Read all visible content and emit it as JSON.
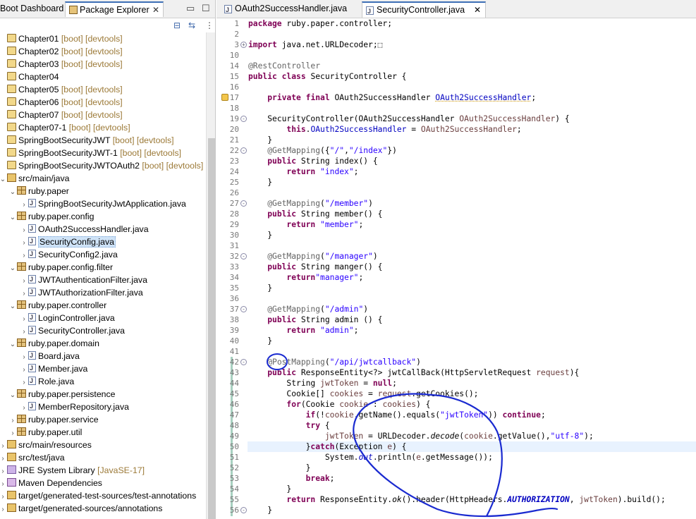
{
  "left_panel": {
    "tabs": [
      {
        "label": "Boot Dashboard"
      },
      {
        "label": "Package Explorer"
      }
    ],
    "tree": [
      {
        "arrow": "",
        "icon": "proj",
        "label": "Chapter01",
        "deco": " [boot] [devtools]",
        "indent": 0
      },
      {
        "arrow": "",
        "icon": "proj",
        "label": "Chapter02",
        "deco": " [boot] [devtools]",
        "indent": 0
      },
      {
        "arrow": "",
        "icon": "proj",
        "label": "Chapter03",
        "deco": " [boot] [devtools]",
        "indent": 0
      },
      {
        "arrow": "",
        "icon": "proj",
        "label": "Chapter04",
        "deco": "",
        "indent": 0
      },
      {
        "arrow": "",
        "icon": "proj",
        "label": "Chapter05",
        "deco": " [boot] [devtools]",
        "indent": 0
      },
      {
        "arrow": "",
        "icon": "proj",
        "label": "Chapter06",
        "deco": " [boot] [devtools]",
        "indent": 0
      },
      {
        "arrow": "",
        "icon": "proj",
        "label": "Chapter07",
        "deco": " [boot] [devtools]",
        "indent": 0
      },
      {
        "arrow": "",
        "icon": "proj",
        "label": "Chapter07-1",
        "deco": " [boot] [devtools]",
        "indent": 0
      },
      {
        "arrow": "",
        "icon": "proj",
        "label": "SpringBootSecurityJWT",
        "deco": " [boot] [devtools]",
        "indent": 0
      },
      {
        "arrow": "",
        "icon": "proj",
        "label": "SpringBootSecurityJWT-1",
        "deco": " [boot] [devtools]",
        "indent": 0
      },
      {
        "arrow": "",
        "icon": "proj",
        "label": "SpringBootSecurityJWTOAuth2",
        "deco": " [boot] [devtools]",
        "indent": 0
      },
      {
        "arrow": "v",
        "icon": "srcf",
        "label": "src/main/java",
        "deco": "",
        "indent": 0
      },
      {
        "arrow": "v",
        "icon": "pkg",
        "label": "ruby.paper",
        "deco": "",
        "indent": 1
      },
      {
        "arrow": ">",
        "icon": "java",
        "label": "SpringBootSecurityJwtApplication.java",
        "deco": "",
        "indent": 2
      },
      {
        "arrow": "v",
        "icon": "pkg",
        "label": "ruby.paper.config",
        "deco": "",
        "indent": 1
      },
      {
        "arrow": ">",
        "icon": "java",
        "label": "OAuth2SuccessHandler.java",
        "deco": "",
        "indent": 2
      },
      {
        "arrow": ">",
        "icon": "java",
        "label": "SecurityConfig.java",
        "deco": "",
        "indent": 2,
        "selected": true
      },
      {
        "arrow": ">",
        "icon": "java",
        "label": "SecurityConfig2.java",
        "deco": "",
        "indent": 2
      },
      {
        "arrow": "v",
        "icon": "pkg",
        "label": "ruby.paper.config.filter",
        "deco": "",
        "indent": 1
      },
      {
        "arrow": ">",
        "icon": "java",
        "label": "JWTAuthenticationFilter.java",
        "deco": "",
        "indent": 2
      },
      {
        "arrow": ">",
        "icon": "java",
        "label": "JWTAuthorizationFilter.java",
        "deco": "",
        "indent": 2
      },
      {
        "arrow": "v",
        "icon": "pkg",
        "label": "ruby.paper.controller",
        "deco": "",
        "indent": 1
      },
      {
        "arrow": ">",
        "icon": "java",
        "label": "LoginController.java",
        "deco": "",
        "indent": 2
      },
      {
        "arrow": ">",
        "icon": "java",
        "label": "SecurityController.java",
        "deco": "",
        "indent": 2
      },
      {
        "arrow": "v",
        "icon": "pkg",
        "label": "ruby.paper.domain",
        "deco": "",
        "indent": 1
      },
      {
        "arrow": ">",
        "icon": "java",
        "label": "Board.java",
        "deco": "",
        "indent": 2
      },
      {
        "arrow": ">",
        "icon": "java",
        "label": "Member.java",
        "deco": "",
        "indent": 2
      },
      {
        "arrow": ">",
        "icon": "java",
        "label": "Role.java",
        "deco": "",
        "indent": 2
      },
      {
        "arrow": "v",
        "icon": "pkg",
        "label": "ruby.paper.persistence",
        "deco": "",
        "indent": 1
      },
      {
        "arrow": ">",
        "icon": "java",
        "label": "MemberRepository.java",
        "deco": "",
        "indent": 2
      },
      {
        "arrow": ">",
        "icon": "pkg",
        "label": "ruby.paper.service",
        "deco": "",
        "indent": 1
      },
      {
        "arrow": ">",
        "icon": "pkg",
        "label": "ruby.paper.util",
        "deco": "",
        "indent": 1
      },
      {
        "arrow": ">",
        "icon": "fold",
        "label": "src/main/resources",
        "deco": "",
        "indent": 0
      },
      {
        "arrow": ">",
        "icon": "fold",
        "label": "src/test/java",
        "deco": "",
        "indent": 0
      },
      {
        "arrow": ">",
        "icon": "lib",
        "label": "JRE System Library",
        "deco": " [JavaSE-17]",
        "indent": 0
      },
      {
        "arrow": ">",
        "icon": "mvn",
        "label": "Maven Dependencies",
        "deco": "",
        "indent": 0
      },
      {
        "arrow": ">",
        "icon": "fold",
        "label": "target/generated-test-sources/test-annotations",
        "deco": "",
        "indent": 0
      },
      {
        "arrow": ">",
        "icon": "fold",
        "label": "target/generated-sources/annotations",
        "deco": "",
        "indent": 0
      }
    ]
  },
  "editor": {
    "tabs": [
      {
        "label": "OAuth2SuccessHandler.java",
        "active": false
      },
      {
        "label": "SecurityController.java",
        "active": true
      }
    ],
    "lines": [
      {
        "n": "1",
        "html": "<span class='kw'>package</span> ruby.paper.controller;"
      },
      {
        "n": "2",
        "html": ""
      },
      {
        "n": "3",
        "fold": "+",
        "html": "<span class='kw'>import</span> java.net.URLDecoder;⬚"
      },
      {
        "n": "10",
        "html": ""
      },
      {
        "n": "14",
        "html": "<span class='an'>@RestController</span>"
      },
      {
        "n": "15",
        "html": "<span class='kw'>public</span> <span class='kw'>class</span> SecurityController {"
      },
      {
        "n": "16",
        "html": ""
      },
      {
        "n": "17",
        "warn": true,
        "html": "    <span class='kw'>private</span> <span class='kw'>final</span> OAuth2SuccessHandler <span class='fd uline'>OAuth2SuccessHandler</span>;"
      },
      {
        "n": "18",
        "html": ""
      },
      {
        "n": "19",
        "fold": "-",
        "html": "    SecurityController(OAuth2SuccessHandler <span class='lv'>OAuth2SuccessHandler</span>) {"
      },
      {
        "n": "20",
        "html": "        <span class='kw'>this</span>.<span class='fd'>OAuth2SuccessHandler</span> = <span class='lv'>OAuth2SuccessHandler</span>;"
      },
      {
        "n": "21",
        "html": "    }"
      },
      {
        "n": "22",
        "fold": "-",
        "html": "    <span class='an'>@GetMapping</span>({<span class='st'>\"/\"</span>,<span class='st'>\"/index\"</span>})"
      },
      {
        "n": "23",
        "html": "    <span class='kw'>public</span> String index() {"
      },
      {
        "n": "24",
        "html": "        <span class='kw'>return</span> <span class='st'>\"index\"</span>;"
      },
      {
        "n": "25",
        "html": "    }"
      },
      {
        "n": "26",
        "html": ""
      },
      {
        "n": "27",
        "fold": "-",
        "html": "    <span class='an'>@GetMapping</span>(<span class='st'>\"/member\"</span>)"
      },
      {
        "n": "28",
        "html": "    <span class='kw'>public</span> String member() {"
      },
      {
        "n": "29",
        "html": "        <span class='kw'>return</span> <span class='st'>\"member\"</span>;"
      },
      {
        "n": "30",
        "html": "    }"
      },
      {
        "n": "31",
        "html": ""
      },
      {
        "n": "32",
        "fold": "-",
        "html": "    <span class='an'>@GetMapping</span>(<span class='st'>\"/manager\"</span>)"
      },
      {
        "n": "33",
        "html": "    <span class='kw'>public</span> String manger() {"
      },
      {
        "n": "34",
        "html": "        <span class='kw'>return</span><span class='st'>\"manager\"</span>;"
      },
      {
        "n": "35",
        "html": "    }"
      },
      {
        "n": "36",
        "html": ""
      },
      {
        "n": "37",
        "fold": "-",
        "html": "    <span class='an'>@GetMapping</span>(<span class='st'>\"/admin\"</span>)"
      },
      {
        "n": "38",
        "html": "    <span class='kw'>public</span> String admin () {"
      },
      {
        "n": "39",
        "html": "        <span class='kw'>return</span> <span class='st'>\"admin\"</span>;"
      },
      {
        "n": "40",
        "html": "    }"
      },
      {
        "n": "41",
        "html": ""
      },
      {
        "n": "42",
        "fold": "-",
        "html": "    <span class='an'>@PostMapping</span>(<span class='st'>\"/api/jwtcallback\"</span>)"
      },
      {
        "n": "43",
        "html": "    <span class='kw'>public</span> ResponseEntity&lt;?&gt; jwtCallBack(HttpServletRequest <span class='lv'>request</span>){"
      },
      {
        "n": "44",
        "html": "        String <span class='lv'>jwtToken</span> = <span class='kw'>null</span>;"
      },
      {
        "n": "45",
        "html": "        Cookie[] <span class='lv'>cookies</span> = <span class='lv'>request</span>.getCookies();"
      },
      {
        "n": "46",
        "html": "        <span class='kw'>for</span>(Cookie <span class='lv'>cookie</span> : <span class='lv'>cookies</span>) {"
      },
      {
        "n": "47",
        "html": "            <span class='kw'>if</span>(!<span class='lv'>cookie</span>.getName().equals(<span class='st'>\"jwtToken\"</span>)) <span class='kw'>continue</span>;"
      },
      {
        "n": "48",
        "html": "            <span class='kw'>try</span> {"
      },
      {
        "n": "49",
        "html": "                <span class='lv'>jwtToken</span> = URLDecoder.<span class='it'>decode</span>(<span class='lv'>cookie</span>.getValue(),<span class='st'>\"utf-8\"</span>);"
      },
      {
        "n": "50",
        "hl": true,
        "html": "            }<span class='kw'>catch</span>(Exception <span class='lv'>e</span>) {"
      },
      {
        "n": "51",
        "html": "                System.<span class='sfd' style='font-weight:normal'>out</span>.println(<span class='lv'>e</span>.getMessage());"
      },
      {
        "n": "52",
        "html": "            }"
      },
      {
        "n": "53",
        "html": "            <span class='kw'>break</span>;"
      },
      {
        "n": "54",
        "html": "        }"
      },
      {
        "n": "55",
        "html": "        <span class='kw'>return</span> ResponseEntity.<span class='it'>ok</span>().header(HttpHeaders.<span class='sfd'>AUTHORIZATION</span>, <span class='lv'>jwtToken</span>).build();"
      },
      {
        "n": "56",
        "fold": "-",
        "html": "    }"
      }
    ]
  },
  "colors": {
    "keyword": "#7f0055",
    "string": "#2a00ff",
    "annotation": "#646464",
    "field": "#0000c0",
    "ink": "#1a2ad0"
  }
}
